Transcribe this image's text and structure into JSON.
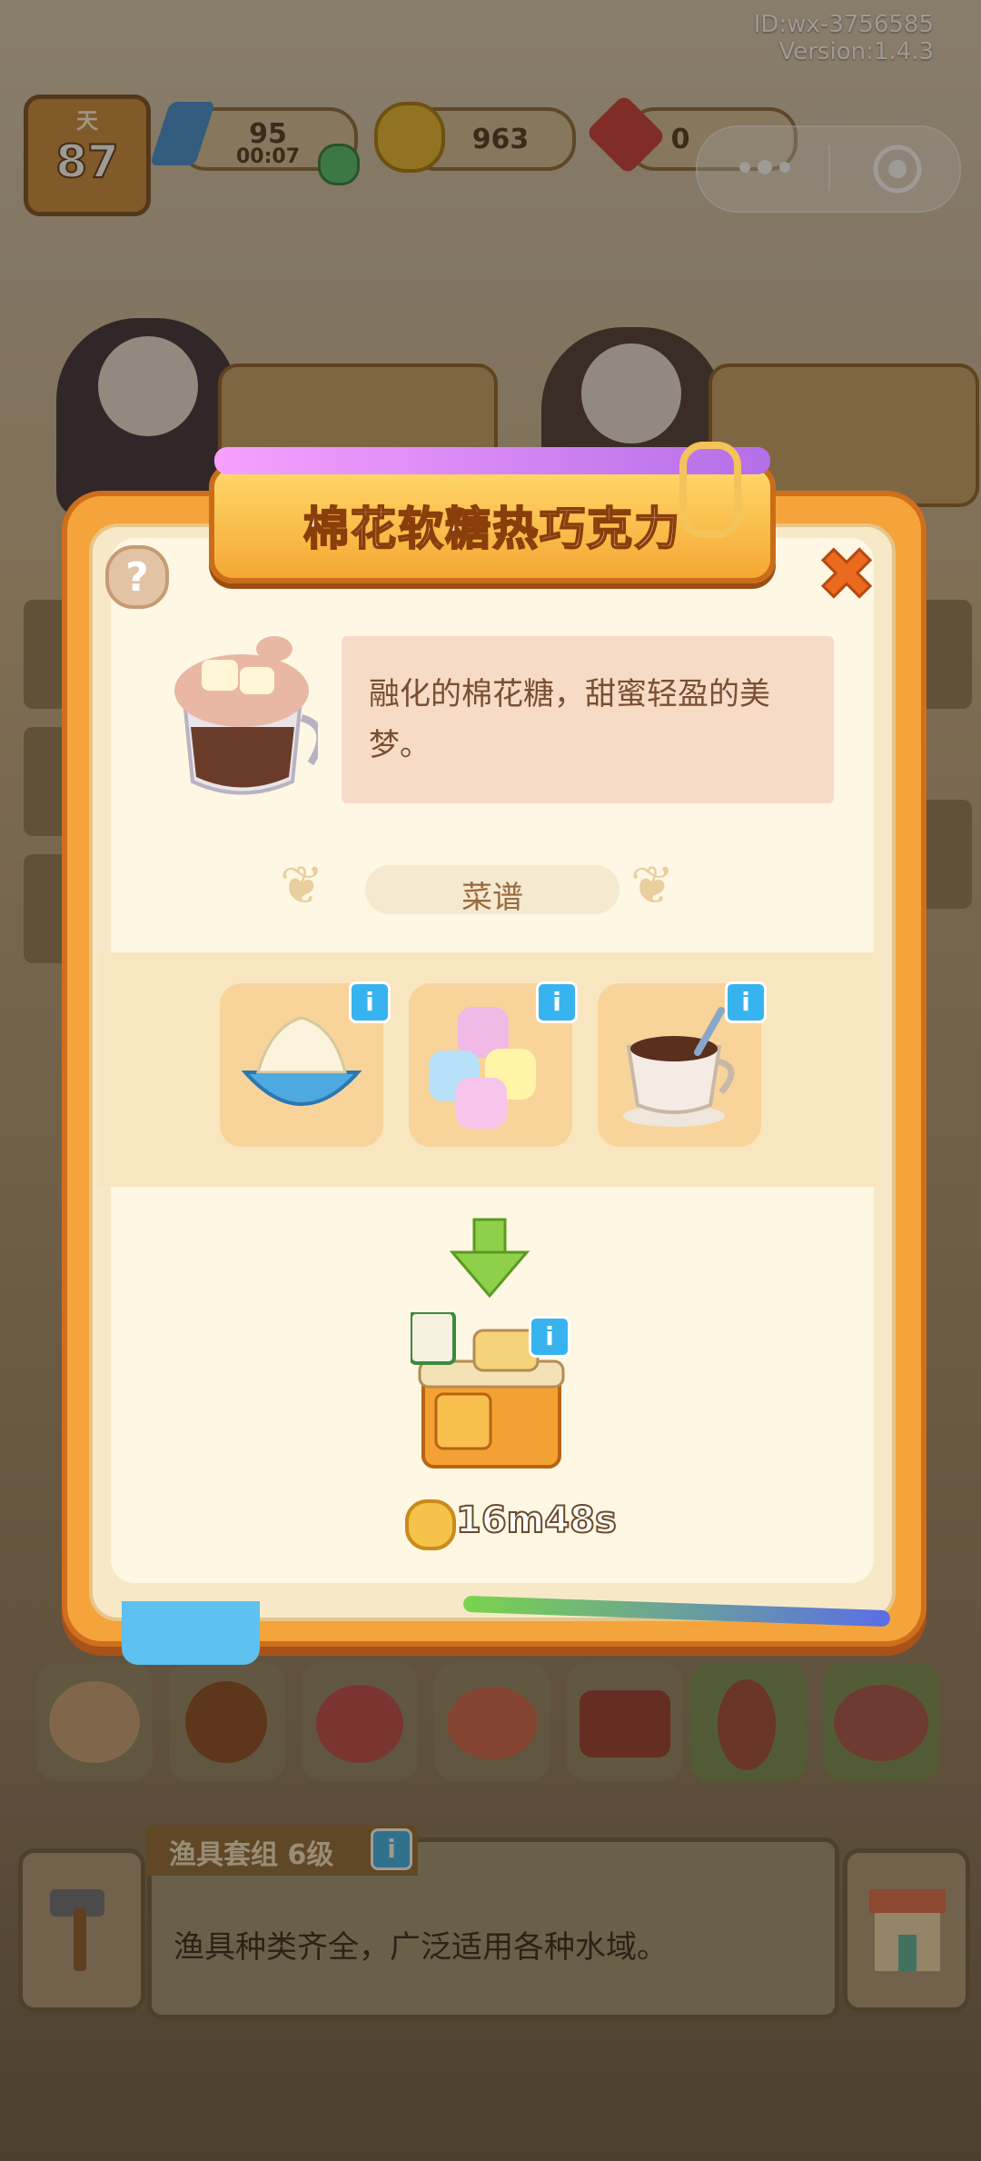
{
  "debug": {
    "id": "ID:wx-3756585",
    "version": "Version:1.4.3"
  },
  "hud": {
    "day_label": "天",
    "day_value": "87",
    "energy": "95",
    "energy_timer": "00:07",
    "coins": "963",
    "gems": "0"
  },
  "modal": {
    "title": "棉花软糖热巧克力",
    "description": "融化的棉花糖，甜蜜轻盈的美梦。",
    "recipe_label": "菜谱",
    "help_symbol": "?",
    "close_symbol": "✖",
    "info_symbol": "i",
    "timer": "16m48s"
  },
  "info_bar": {
    "title": "渔具套组 6级",
    "text": "渔具种类齐全，广泛适用各种水域。"
  },
  "colors": {
    "modal_orange": "#f4a43a",
    "panel_cream": "#fdf7e3",
    "info_blue": "#37b4ef",
    "title_text": "#ffffff"
  }
}
